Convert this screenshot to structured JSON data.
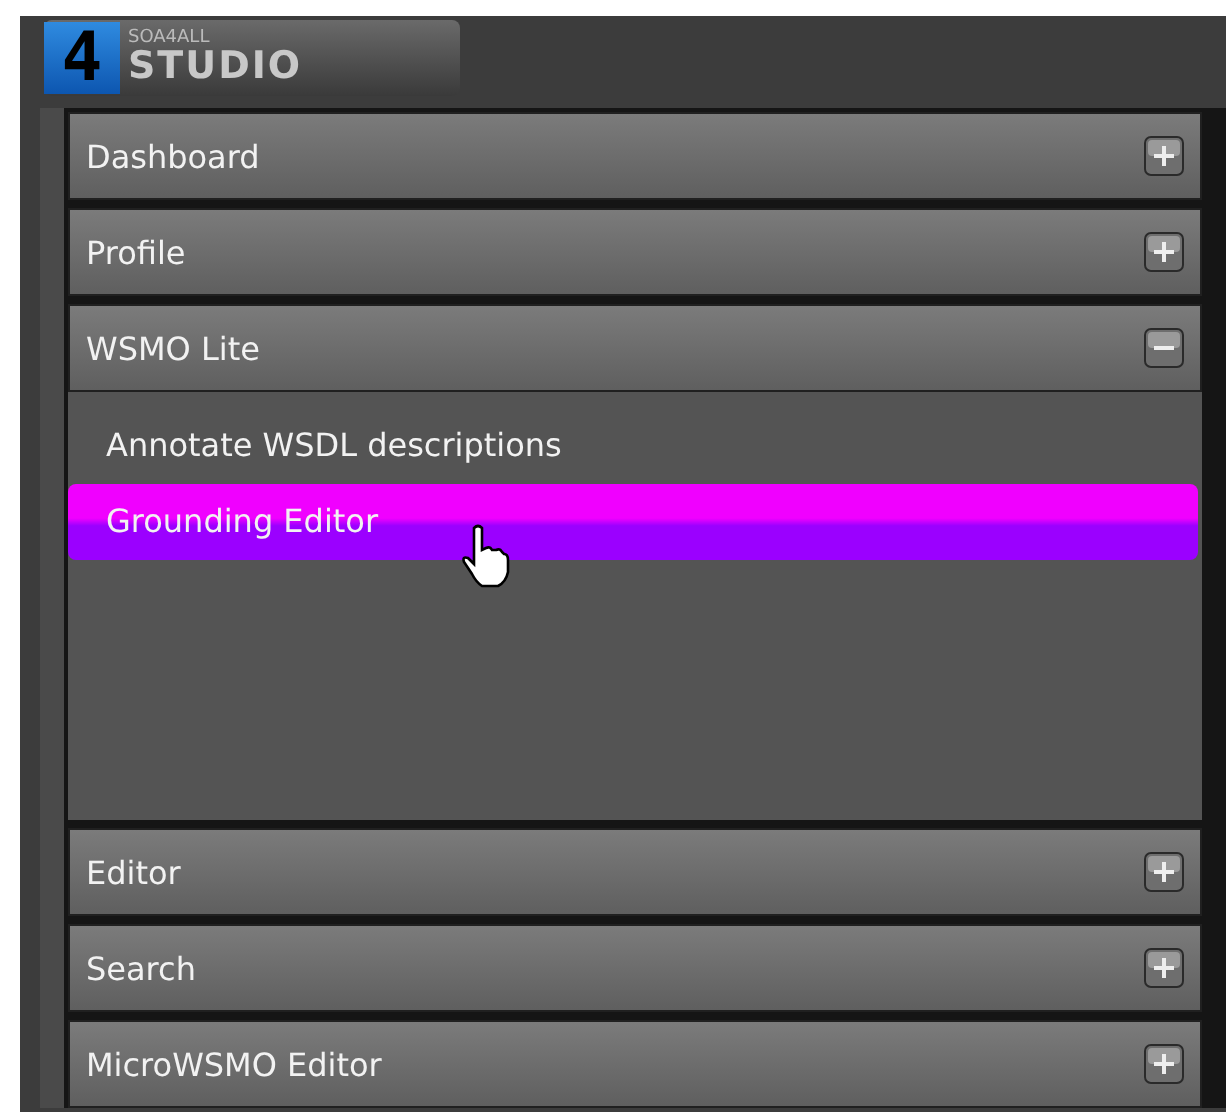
{
  "logo": {
    "mark": "4",
    "small": "SOA4ALL",
    "big": "STUDIO"
  },
  "sections": [
    {
      "label": "Dashboard",
      "expanded": false
    },
    {
      "label": "Profile",
      "expanded": false
    },
    {
      "label": "WSMO Lite",
      "expanded": true,
      "items": [
        {
          "label": "Annotate WSDL descriptions",
          "selected": false
        },
        {
          "label": "Grounding Editor",
          "selected": true
        }
      ]
    },
    {
      "label": "Editor",
      "expanded": false
    },
    {
      "label": "Search",
      "expanded": false
    },
    {
      "label": "MicroWSMO Editor",
      "expanded": false
    }
  ]
}
